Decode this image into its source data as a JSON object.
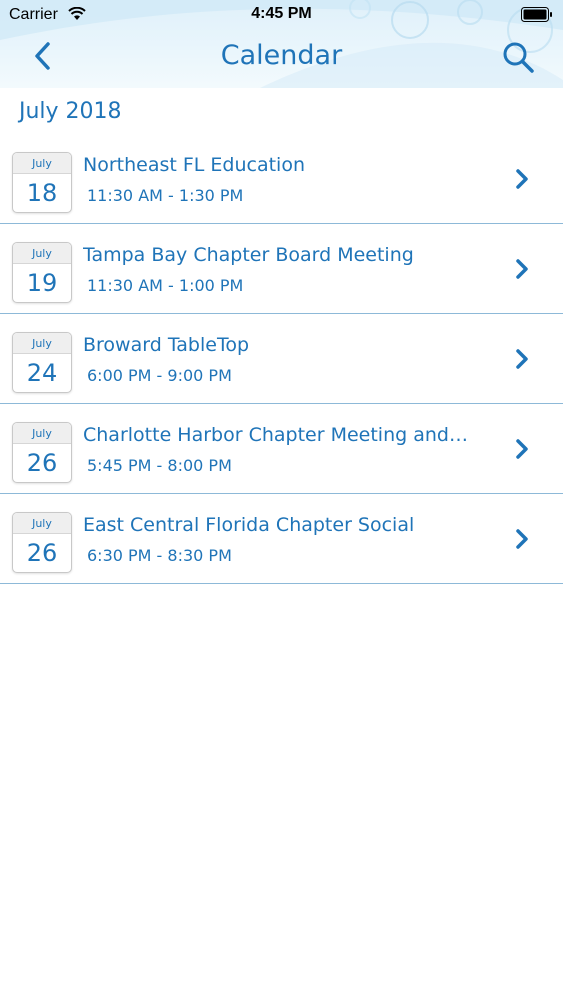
{
  "status_bar": {
    "carrier": "Carrier",
    "time": "4:45 PM"
  },
  "nav": {
    "title": "Calendar",
    "back_icon": "chevron-left-icon",
    "search_icon": "search-icon"
  },
  "colors": {
    "accent": "#1f74b8",
    "divider": "#8db9d8",
    "header_bg": "#e4f3fb"
  },
  "month_header": "July 2018",
  "events": [
    {
      "month": "July",
      "day": "18",
      "title": "Northeast FL Education",
      "time": "11:30 AM - 1:30 PM"
    },
    {
      "month": "July",
      "day": "19",
      "title": "Tampa Bay Chapter Board Meeting",
      "time": "11:30 AM - 1:00 PM"
    },
    {
      "month": "July",
      "day": "24",
      "title": "Broward TableTop",
      "time": "6:00 PM - 9:00 PM"
    },
    {
      "month": "July",
      "day": "26",
      "title": "Charlotte Harbor Chapter Meeting and…",
      "time": "5:45 PM - 8:00 PM"
    },
    {
      "month": "July",
      "day": "26",
      "title": "East Central Florida Chapter Social",
      "time": "6:30 PM - 8:30 PM"
    }
  ]
}
